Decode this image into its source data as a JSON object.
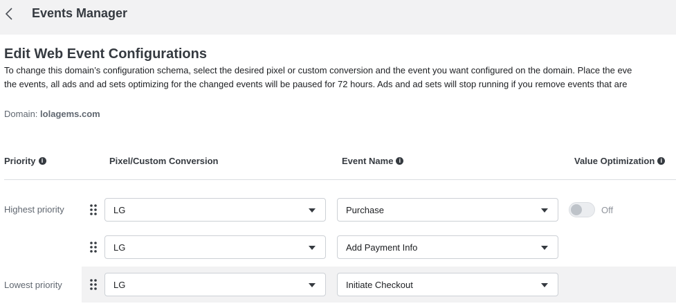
{
  "header": {
    "title": "Events Manager"
  },
  "page": {
    "title": "Edit Web Event Configurations",
    "description_line1": "To change this domain’s configuration schema, select the desired pixel or custom conversion and the event you want configured on the domain. Place the eve",
    "description_line2": "the events, all ads and ad sets optimizing for the changed events will be paused for 72 hours. Ads and ad sets will stop running if you remove events that are",
    "domain_label": "Domain:",
    "domain_value": "lolagems.com"
  },
  "columns": {
    "priority": "Priority",
    "pixel": "Pixel/Custom Conversion",
    "event": "Event Name",
    "value_opt": "Value Optimization"
  },
  "rows": [
    {
      "priority_label": "Highest priority",
      "pixel": "LG",
      "event": "Purchase",
      "value_optimization": "Off"
    },
    {
      "priority_label": "",
      "pixel": "LG",
      "event": "Add Payment Info"
    },
    {
      "priority_label": "Lowest priority",
      "pixel": "LG",
      "event": "Initiate Checkout"
    }
  ],
  "icons": {
    "back": "chevron-left-icon",
    "info": "info-icon",
    "drag": "drag-handle-icon",
    "caret": "caret-down-icon"
  },
  "colors": {
    "header_bg": "#f2f2f3",
    "title_text": "#353a40",
    "muted_text": "#606770",
    "border": "#ccd0d5"
  }
}
